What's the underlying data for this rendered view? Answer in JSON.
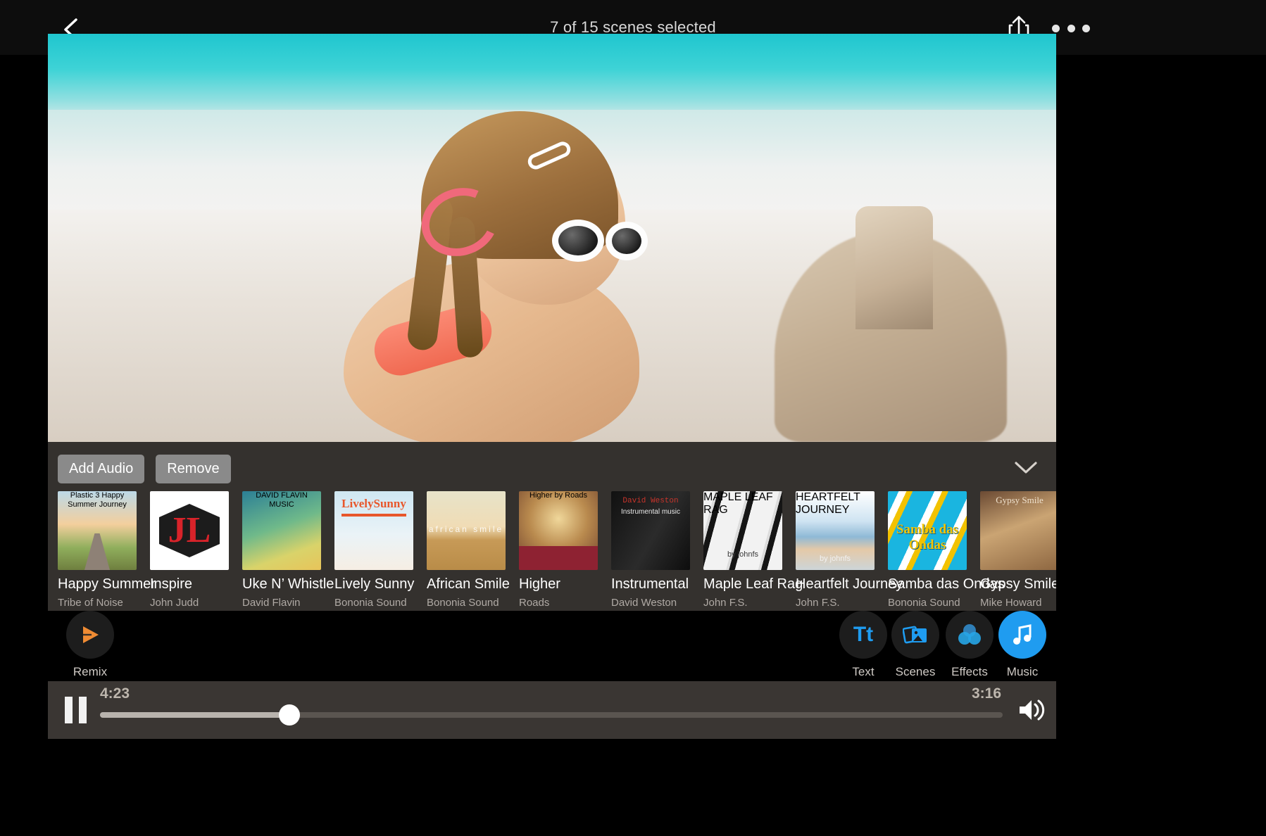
{
  "topbar": {
    "title": "7 of 15 scenes selected",
    "back_icon": "chevron-left-icon",
    "share_icon": "share-icon",
    "more_icon": "more-options-icon"
  },
  "preview": {
    "description": "girl-on-beach-photo"
  },
  "audio_panel": {
    "add_audio_label": "Add Audio",
    "remove_label": "Remove",
    "collapse_icon": "chevron-down-icon",
    "tracks": [
      {
        "title": "Happy Summer",
        "artist": "Tribe of Noise",
        "art_class": "a-happy",
        "art_text": "Plastic 3 Happy Summer Journey"
      },
      {
        "title": "Inspire",
        "artist": "John Judd",
        "art_class": "a-inspire",
        "art_text": "JL"
      },
      {
        "title": "Uke N’ Whistle",
        "artist": "David Flavin",
        "art_class": "a-uke",
        "art_text": "DAVID FLAVIN MUSIC"
      },
      {
        "title": "Lively Sunny",
        "artist": "Bononia Sound",
        "art_class": "a-lively",
        "art_text": "LivelySunny"
      },
      {
        "title": "African Smile",
        "artist": "Bononia Sound",
        "art_class": "a-african",
        "art_text": "african smile"
      },
      {
        "title": "Higher",
        "artist": "Roads",
        "art_class": "a-higher",
        "art_text": "Higher by Roads"
      },
      {
        "title": "Instrumental",
        "artist": "David Weston",
        "art_class": "a-instr",
        "art_text": "David Weston",
        "art_text2": "Instrumental music"
      },
      {
        "title": "Maple Leaf Rag",
        "artist": "John F.S.",
        "art_class": "a-maple",
        "art_text": "MAPLE LEAF RAG",
        "art_text2": "by johnfs"
      },
      {
        "title": "Heartfelt Journey",
        "artist": "John F.S.",
        "art_class": "a-heart",
        "art_text": "HEARTFELT JOURNEY",
        "art_text2": "by johnfs"
      },
      {
        "title": "Samba das Ondas",
        "artist": "Bononia Sound",
        "art_class": "a-samba",
        "art_text": "Samba das Ondas"
      },
      {
        "title": "Gypsy Smile",
        "artist": "Mike Howard",
        "art_class": "a-gypsy",
        "art_text": "Gypsy Smile"
      }
    ]
  },
  "tools": [
    {
      "label": "Remix",
      "icon": "remix-icon",
      "active": false
    },
    {
      "label": "Text",
      "icon": "text-icon",
      "active": false
    },
    {
      "label": "Scenes",
      "icon": "scenes-icon",
      "active": false
    },
    {
      "label": "Effects",
      "icon": "effects-icon",
      "active": false
    },
    {
      "label": "Music",
      "icon": "music-note-icon",
      "active": true
    }
  ],
  "playback": {
    "pause_icon": "pause-icon",
    "current_time": "4:23",
    "total_time": "3:16",
    "progress_percent": 21,
    "volume_icon": "volume-icon"
  },
  "colors": {
    "accent_blue": "#1f9cf0",
    "accent_orange": "#ef8b33",
    "panel_bg": "#383532",
    "playbar_bg": "#3a3633"
  }
}
